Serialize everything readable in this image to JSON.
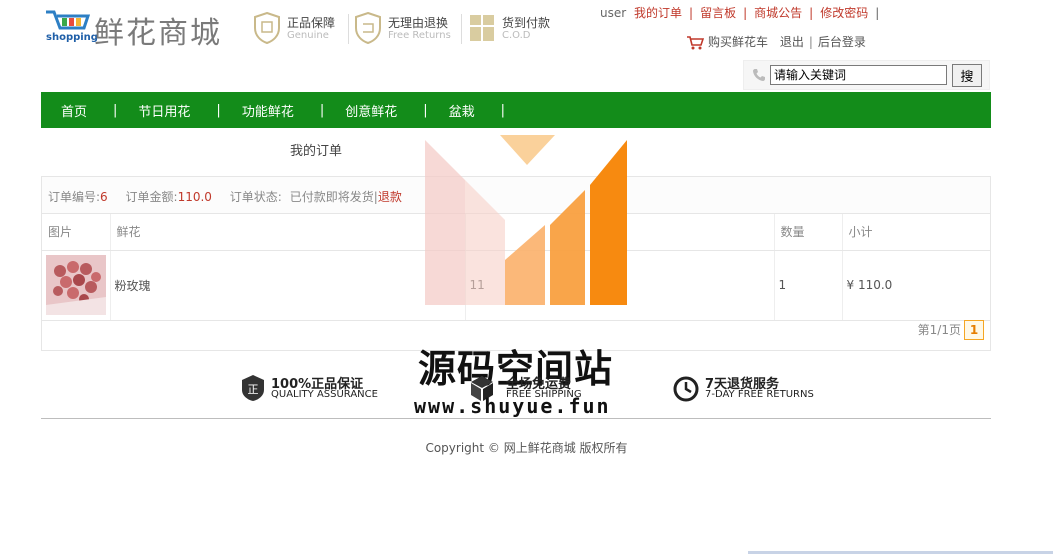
{
  "logo": {
    "brand": "鲜花商城",
    "shop_word": "shopping"
  },
  "guarantees": [
    {
      "title": "正品保障",
      "sub": "Genuine",
      "icon": "shield-icon"
    },
    {
      "title": "无理由退换",
      "sub": "Free Returns",
      "icon": "return-shield-icon"
    },
    {
      "title": "货到付款",
      "sub": "C.O.D",
      "icon": "gift-box-icon"
    }
  ],
  "toplinks": {
    "user": "user",
    "links": [
      "我的订单",
      "留言板",
      "商城公告",
      "修改密码"
    ]
  },
  "cartline": {
    "cart": "购买鲜花车",
    "logout": "退出",
    "admin": "后台登录"
  },
  "search": {
    "placeholder": "请输入关键词",
    "button": "搜"
  },
  "nav": [
    "首页",
    "节日用花",
    "功能鲜花",
    "创意鲜花",
    "盆栽"
  ],
  "page_title": "我的订单",
  "order": {
    "number_label": "订单编号:",
    "number": "6",
    "amount_label": "订单金额:",
    "amount": "110.0",
    "status_label": "订单状态:",
    "status": "已付款即将发货|",
    "refund": "退款"
  },
  "table": {
    "headers": [
      "图片",
      "鲜花",
      "",
      "数量",
      "小计"
    ],
    "rows": [
      {
        "name": "粉玫瑰",
        "price": "11",
        "qty": "1",
        "subtotal": "¥ 110.0"
      }
    ]
  },
  "pager": {
    "text": "第1/1页",
    "current": "1"
  },
  "services": [
    {
      "title": "100%正品保证",
      "sub": "QUALITY ASSURANCE",
      "icon": "badge-zheng-icon"
    },
    {
      "title": "全场免运费",
      "sub": "FREE SHIPPING",
      "icon": "package-cube-icon"
    },
    {
      "title": "7天退货服务",
      "sub": "7-DAY FREE RETURNS",
      "icon": "clock-icon"
    }
  ],
  "copyright": "Copyright © 网上鲜花商城 版权所有",
  "watermark": {
    "title": "源码空间站",
    "url": "www.shuyue.fun"
  },
  "colors": {
    "nav_green": "#138c1a",
    "link_red": "#c0392b",
    "pager_orange": "#f5a623"
  }
}
